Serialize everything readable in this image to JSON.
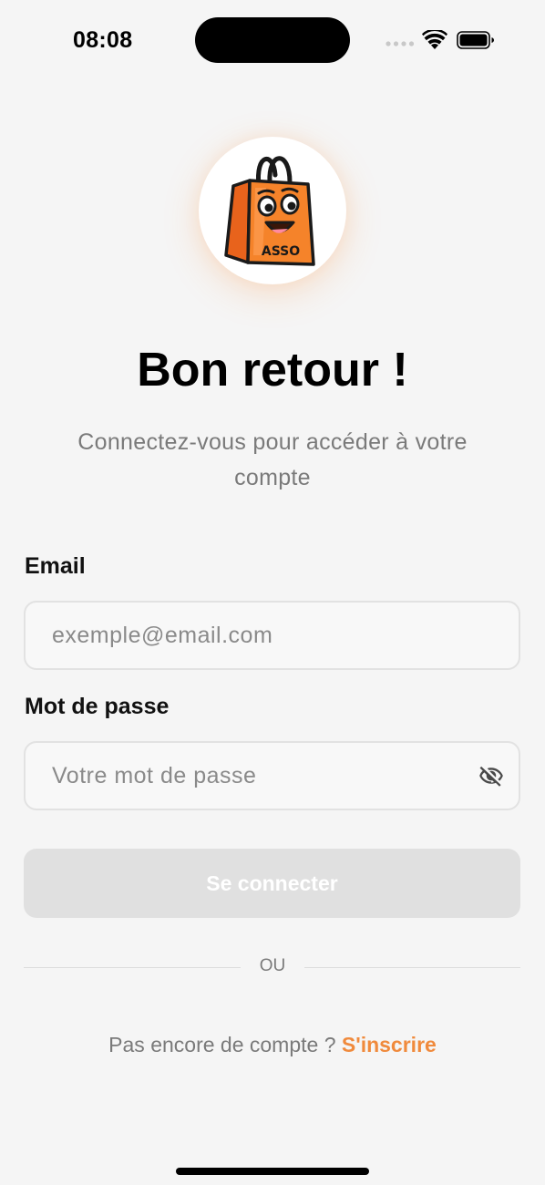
{
  "status_bar": {
    "time": "08:08",
    "icons": [
      "signal-icon",
      "wifi-icon",
      "battery-icon"
    ]
  },
  "logo": {
    "text": "ASSO",
    "icon": "shopping-bag-mascot-icon"
  },
  "header": {
    "title": "Bon retour !",
    "subtitle": "Connectez-vous pour accéder à votre compte"
  },
  "form": {
    "email": {
      "label": "Email",
      "placeholder": "exemple@email.com",
      "value": ""
    },
    "password": {
      "label": "Mot de passe",
      "placeholder": "Votre mot de passe",
      "value": "",
      "toggle_icon": "eye-off-icon"
    },
    "submit_label": "Se connecter"
  },
  "divider": {
    "text": "OU"
  },
  "signup": {
    "prompt": "Pas encore de compte ?",
    "link_label": "S'inscrire"
  },
  "colors": {
    "background": "#f5f5f5",
    "accent": "#f08a3c",
    "button_disabled": "#e0e0e0",
    "muted_text": "#7a7a7a"
  }
}
